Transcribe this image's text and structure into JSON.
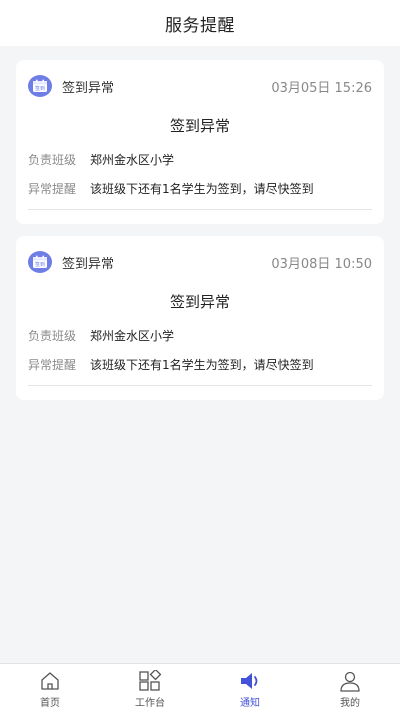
{
  "header": {
    "title": "服务提醒"
  },
  "notices": [
    {
      "type_label": "签到异常",
      "time": "03月05日 15:26",
      "title": "签到异常",
      "rows": [
        {
          "label": "负责班级",
          "value": "郑州金水区小学"
        },
        {
          "label": "异常提醒",
          "value": "该班级下还有1名学生为签到，请尽快签到"
        }
      ]
    },
    {
      "type_label": "签到异常",
      "time": "03月08日 10:50",
      "title": "签到异常",
      "rows": [
        {
          "label": "负责班级",
          "value": "郑州金水区小学"
        },
        {
          "label": "异常提醒",
          "value": "该班级下还有1名学生为签到，请尽快签到"
        }
      ]
    }
  ],
  "icon_badge_text": "签到",
  "tabs": [
    {
      "label": "首页",
      "icon": "home-icon",
      "active": false
    },
    {
      "label": "工作台",
      "icon": "workbench-icon",
      "active": false
    },
    {
      "label": "通知",
      "icon": "speaker-icon",
      "active": true
    },
    {
      "label": "我的",
      "icon": "user-icon",
      "active": false
    }
  ],
  "colors": {
    "accent": "#4352d8",
    "icon_bg": "#6f7de6",
    "page_bg": "#f4f5f7"
  }
}
